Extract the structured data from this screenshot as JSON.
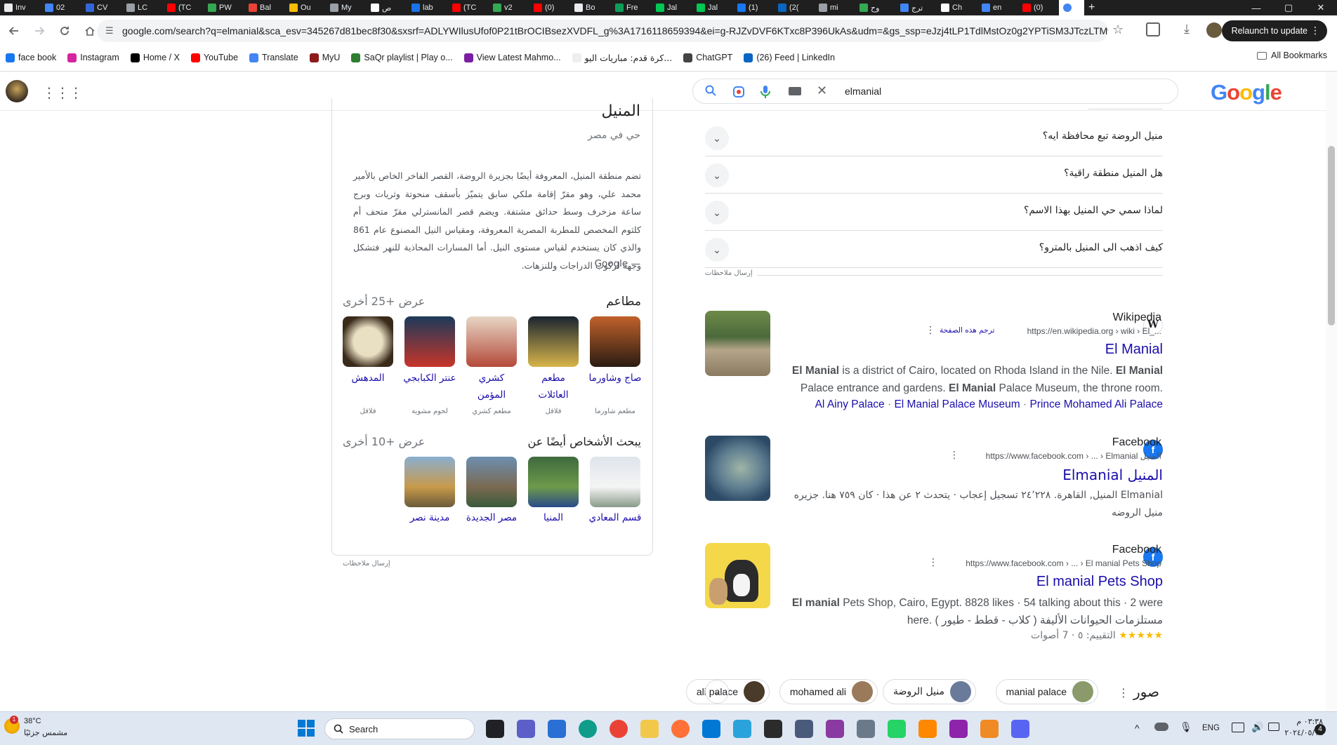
{
  "tabs": [
    "Inv",
    "02",
    "CV",
    "LC",
    "(TC",
    "PW",
    "Bal",
    "Ou",
    "My",
    "ص",
    "lab",
    "(TC",
    "v2",
    "(0)",
    "Bo",
    "Fre",
    "Jal",
    "Jal",
    "(1)",
    "(2(",
    "mi",
    "وح",
    "ترج",
    "Ch",
    "en",
    "(0)"
  ],
  "window_controls": {
    "minimize": "—",
    "maximize": "▢",
    "close": "✕",
    "newtab": "+"
  },
  "address_bar": {
    "url": "google.com/search?q=elmanial&sca_esv=345267d81bec8f30&sxsrf=ADLYWIlusUfof0P21tBrOCIBsezXVDFL_g%3A1716118659394&ei=g-RJZvDVF6KTxc8P396UkAs&udm=&gs_ssp=eJzj4tLP1TdlMstOz0g2YPTiSM3JTczLTMwBAE...",
    "relaunch": "Relaunch to update"
  },
  "bookmarks": [
    {
      "label": "face book",
      "color": "#1877f2"
    },
    {
      "label": "Instagram",
      "color": "#d6249f"
    },
    {
      "label": "Home / X",
      "color": "#000000"
    },
    {
      "label": "YouTube",
      "color": "#ff0000"
    },
    {
      "label": "Translate",
      "color": "#4285f4"
    },
    {
      "label": "MyU",
      "color": "#8b1a1a"
    },
    {
      "label": "SaQr playlist | Play o...",
      "color": "#2e7d32"
    },
    {
      "label": "View Latest Mahmo...",
      "color": "#7b1fa2"
    },
    {
      "label": "كرة قدم: مباريات اليو...",
      "color": "#eeeeee"
    },
    {
      "label": "ChatGPT",
      "color": "#444444"
    },
    {
      "label": "(26) Feed | LinkedIn",
      "color": "#0a66c2"
    }
  ],
  "all_bookmarks": "All Bookmarks",
  "search": {
    "query": "elmanial",
    "logo": "Google"
  },
  "knowledge_panel": {
    "title": "المنيل",
    "subtitle": "حي في مصر",
    "description": "تضم منطقة المنيل، المعروفة أيضًا بجزيرة الروضة، القصر الفاخر الخاص بالأمير محمد علي، وهو مقرّ إقامة ملكي سابق يتميّز بأسقف منحوتة وثريات وبرج ساعة مزخرف وسط حدائق مشتفة. ويضم قصر المانسترلي مقرّ متحف أم كلثوم المخصص للمطربة المصرية المعروفة، ومقياس النيل المصنوع عام 861 والذي كان يستخدم لقياس مستوى النيل. أما المسارات المحاذية للنهر فتشكل وجهة لركوب الدراجات وللنزهات.",
    "source": "Google —",
    "restaurants_heading": "مطاعم",
    "restaurants_more": "عرض +25 أخرى",
    "restaurants": [
      {
        "name": "صاج وشاورما",
        "type": "مطعم شاورما"
      },
      {
        "name": "مطعم العائلات",
        "type": "فلافل"
      },
      {
        "name": "كشري المؤمن",
        "type": "مطعم كشري"
      },
      {
        "name": "عنتر الكبابجي",
        "type": "لحوم مشوية"
      },
      {
        "name": "المدهش",
        "type": "فلافل"
      }
    ],
    "people_heading": "يبحث الأشخاص أيضًا عن",
    "people_more": "عرض +10 أخرى",
    "people": [
      {
        "name": "قسم المعادي"
      },
      {
        "name": "المنيا"
      },
      {
        "name": "مصر الجديدة"
      },
      {
        "name": "مدينة نصر"
      }
    ],
    "feedback": "إرسال ملاحظات"
  },
  "faq": [
    "منيل الروضة تبع محافظة ايه؟",
    "هل المنيل منطقة راقية؟",
    "لماذا سمي حي المنيل بهذا الاسم؟",
    "كيف اذهب الى المنيل بالمترو؟"
  ],
  "faq_feedback": "إرسال ملاحظات",
  "results": [
    {
      "site": "Wikipedia",
      "url": "https://en.wikipedia.org › wiki › El_...",
      "translate": "ترجم هذه الصفحة",
      "title": "El Manial",
      "snippet": "El Manial is a district of Cairo, located on Rhoda Island in the Nile. El Manial Palace entrance and gardens. El Manial Palace Museum, the throne room.",
      "links": [
        "Al Ainy Palace",
        "El Manial Palace Museum",
        "Prince Mohamed Ali Palace"
      ]
    },
    {
      "site": "Facebook",
      "url": "https://www.facebook.com › ... › Elmanial المنيل",
      "title": "Elmanial المنيل",
      "snippet": "Elmanial المنيل, القاهرة. ٢٤٬٢٢٨ تسجيل إعجاب · يتحدث ٢ عن هذا · كان ٧٥٩ هنا. جزيره منيل الروضه"
    },
    {
      "site": "Facebook",
      "url": "https://www.facebook.com › ... › El manial Pets Shop",
      "title": "El manial Pets Shop",
      "snippet": "El manial Pets Shop, Cairo, Egypt. 8828 likes · 54 talking about this · 2 were here. ( كلاب - قطط - طيور ) مستلزمات الحيوانات الأليفة",
      "rating": "★★★★★ التقييم: ٥ · 7 أصوات"
    }
  ],
  "images_section": {
    "label": "صور",
    "chips": [
      "manial palace",
      "منيل الروضة",
      "mohamed ali",
      "ali palace"
    ]
  },
  "taskbar": {
    "weather_temp": "38°C",
    "weather_desc": "مشمس جزئيًا",
    "search": "Search",
    "lang": "ENG",
    "time": "٠٣:٣٨ م",
    "date": "٢٠٢٤/٠٥/١٩",
    "notif": "4"
  }
}
